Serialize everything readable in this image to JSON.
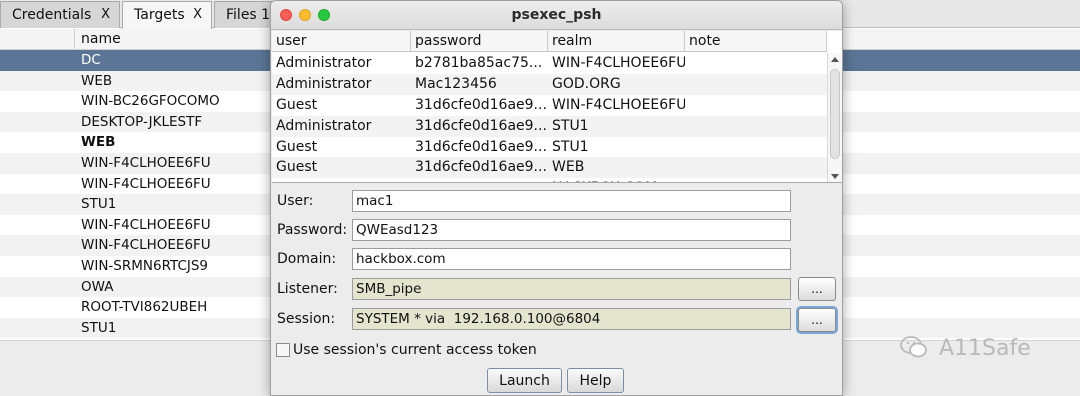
{
  "background": {
    "tabs": [
      {
        "label": "Credentials",
        "close": "X"
      },
      {
        "label": "Targets",
        "close": "X"
      },
      {
        "label": "Files 1",
        "close": ""
      }
    ],
    "column_header": "name",
    "rows": [
      "DC",
      "WEB",
      "WIN-BC26GFOCOMO",
      "DESKTOP-JKLESTF",
      "WEB",
      "WIN-F4CLHOEE6FU",
      "WIN-F4CLHOEE6FU",
      "STU1",
      "WIN-F4CLHOEE6FU",
      "WIN-F4CLHOEE6FU",
      "WIN-SRMN6RTCJS9",
      "OWA",
      "ROOT-TVI862UBEH",
      "STU1"
    ],
    "selected_row_index": 0,
    "bold_row_index": 4
  },
  "dialog": {
    "title": "psexec_psh",
    "table": {
      "columns": [
        "user",
        "password",
        "realm",
        "note"
      ],
      "rows": [
        [
          "Administrator",
          "b2781ba85ac75...",
          "WIN-F4CLHOEE6FU",
          ""
        ],
        [
          "Administrator",
          "Mac123456",
          "GOD.ORG",
          ""
        ],
        [
          "Guest",
          "31d6cfe0d16ae9...",
          "WIN-F4CLHOEE6FU",
          ""
        ],
        [
          "Administrator",
          "31d6cfe0d16ae9...",
          "STU1",
          ""
        ],
        [
          "Guest",
          "31d6cfe0d16ae9...",
          "STU1",
          ""
        ],
        [
          "Guest",
          "31d6cfe0d16ae9...",
          "WEB",
          ""
        ],
        [
          "",
          "",
          "HACKBOX.COM",
          ""
        ]
      ]
    },
    "form": {
      "user_label": "User:",
      "user_value": "mac1",
      "password_label": "Password:",
      "password_value": "QWEasd123",
      "domain_label": "Domain:",
      "domain_value": "hackbox.com",
      "listener_label": "Listener:",
      "listener_value": "SMB_pipe",
      "session_label": "Session:",
      "session_value": "SYSTEM * via  192.168.0.100@6804",
      "browse_label": "...",
      "token_label": "Use session's current access token"
    },
    "buttons": {
      "launch": "Launch",
      "help": "Help"
    }
  },
  "watermark": {
    "text": "A11Safe",
    "icon": "wechat-icon"
  }
}
